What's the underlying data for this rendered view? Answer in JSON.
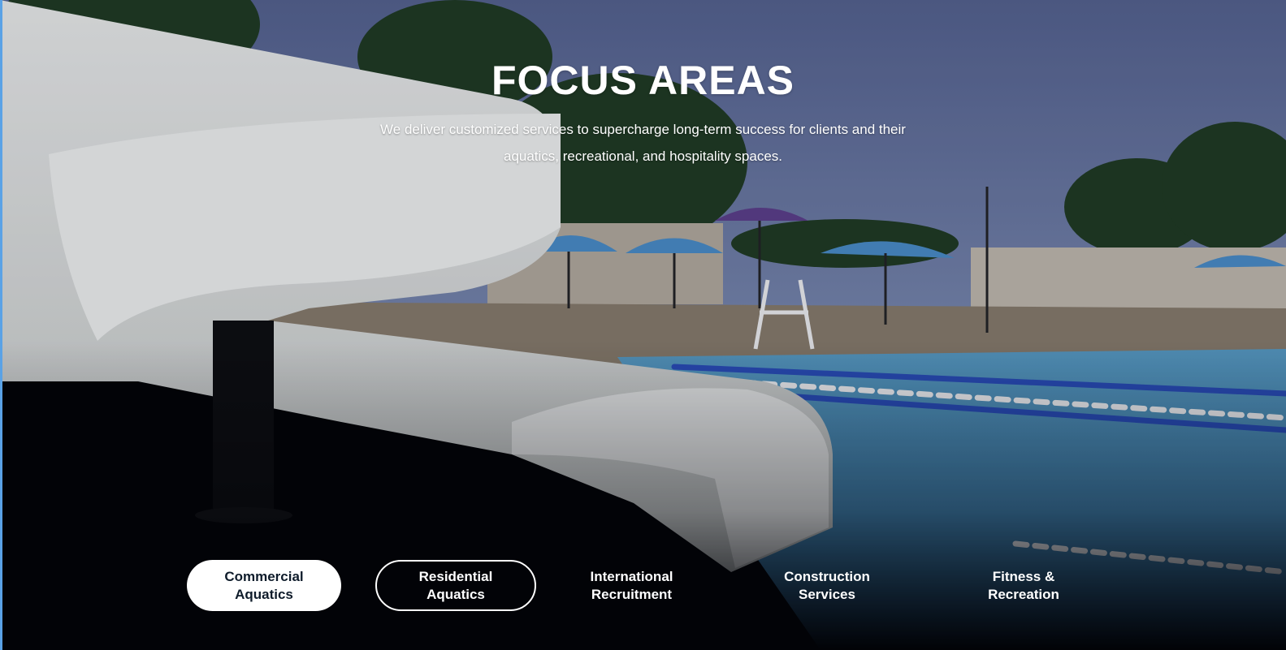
{
  "hero": {
    "title": "FOCUS AREAS",
    "subtitle": "We deliver customized services to supercharge long-term success for clients and their aquatics, recreational, and hospitality spaces."
  },
  "tabs": [
    {
      "label": "Commercial\nAquatics",
      "state": "active"
    },
    {
      "label": "Residential\nAquatics",
      "state": "hover"
    },
    {
      "label": "International\nRecruitment",
      "state": "default"
    },
    {
      "label": "Construction\nServices",
      "state": "default"
    },
    {
      "label": "Fitness &\nRecreation",
      "state": "default"
    }
  ],
  "colors": {
    "sky": "#5f6f9c",
    "pool": "#3f86b8",
    "slide": "#e9ebe8",
    "tab_active_bg": "#ffffff",
    "tab_active_text": "#0f1c2b"
  }
}
